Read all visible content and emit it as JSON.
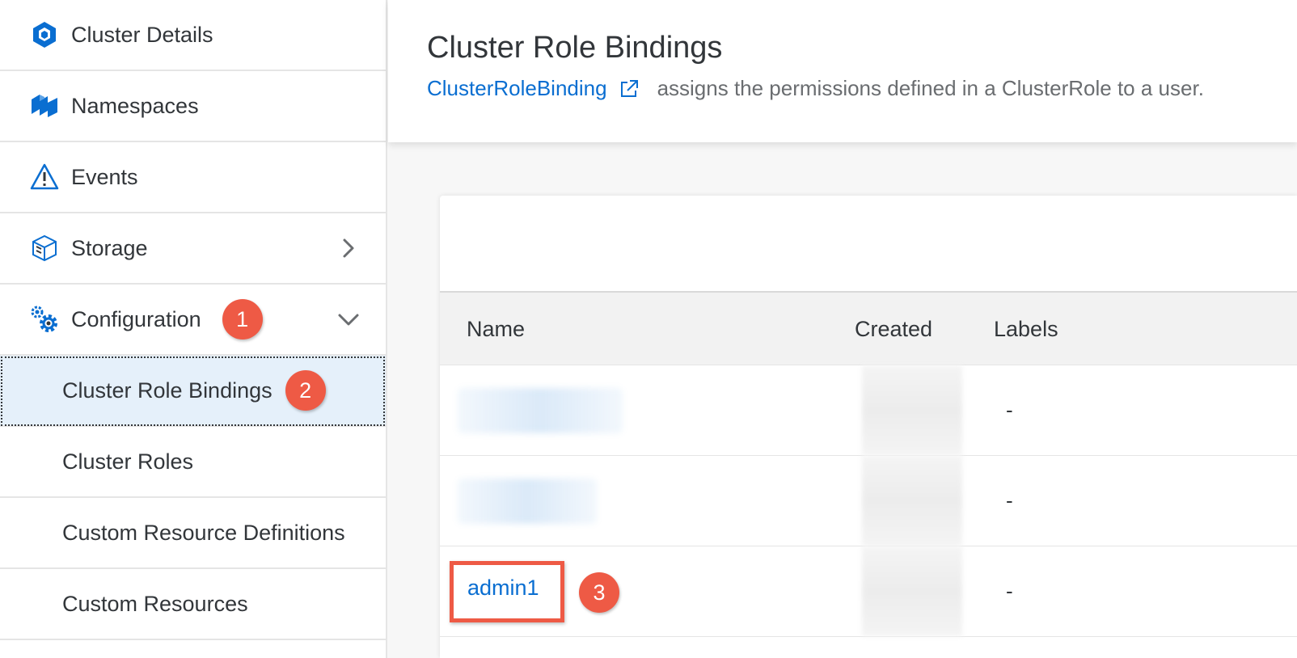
{
  "sidebar": {
    "items": [
      {
        "label": "Cluster Details",
        "icon": "cube-icon"
      },
      {
        "label": "Namespaces",
        "icon": "namespaces-icon"
      },
      {
        "label": "Events",
        "icon": "warning-icon"
      },
      {
        "label": "Storage",
        "icon": "storage-icon",
        "expand": "chevron-right-icon"
      },
      {
        "label": "Configuration",
        "icon": "gears-icon",
        "expand": "chevron-down-icon",
        "badge": "1"
      }
    ],
    "sub_items": [
      {
        "label": "Cluster Role Bindings",
        "selected": true,
        "badge": "2"
      },
      {
        "label": "Cluster Roles"
      },
      {
        "label": "Custom Resource Definitions"
      },
      {
        "label": "Custom Resources"
      }
    ]
  },
  "header": {
    "title": "Cluster Role Bindings",
    "link_text": "ClusterRoleBinding",
    "description": "assigns the permissions defined in a ClusterRole to a user."
  },
  "table": {
    "columns": [
      "Name",
      "Created",
      "Labels"
    ],
    "rows": [
      {
        "name": "",
        "labels": "-"
      },
      {
        "name": "",
        "labels": "-"
      },
      {
        "name": "admin1",
        "labels": "-",
        "badge": "3"
      }
    ]
  },
  "colors": {
    "accent": "#0a6ed1",
    "badge": "#ee5a45",
    "selected_bg": "#e5f0fa"
  }
}
